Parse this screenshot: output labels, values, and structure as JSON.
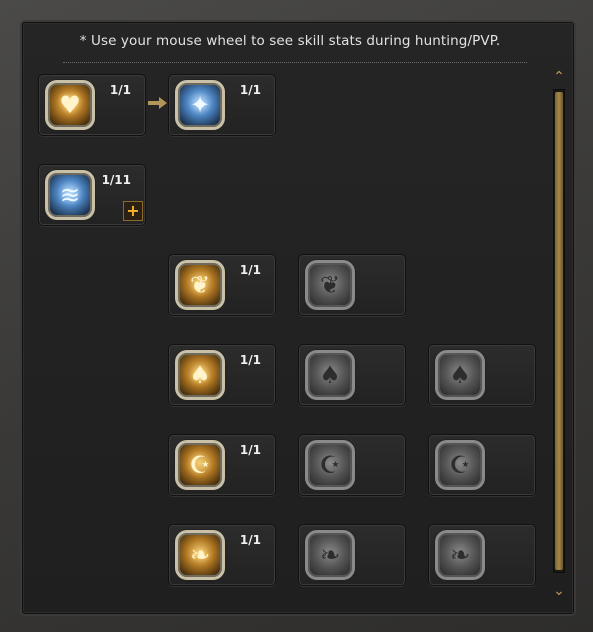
{
  "hint": "* Use your mouse wheel to see skill stats during hunting/PVP.",
  "skills": {
    "r1": {
      "icon": "heart-icon",
      "count": "1/1"
    },
    "r1b": {
      "icon": "sparkle-icon",
      "count": "1/1"
    },
    "r2": {
      "icon": "water-aura-icon",
      "count": "1/11",
      "plus_label": "+"
    },
    "r3": {
      "icon": "flame-icon",
      "count": "1/1"
    },
    "r4": {
      "icon": "card-shield-icon",
      "count": "1/1"
    },
    "r5": {
      "icon": "crescent-star-icon",
      "count": "1/1"
    },
    "r6": {
      "icon": "tree-flame-icon",
      "count": "1/1"
    }
  },
  "glyphs": {
    "heart": "♥",
    "sparkle": "✦",
    "water": "≋",
    "flame": "❦",
    "card": "♠",
    "moon": "☪",
    "tree": "❧"
  },
  "scroll": {
    "up": "⌃",
    "down": "⌄"
  },
  "colors": {
    "accent": "#ffb22b",
    "text": "#f0f0f0"
  }
}
